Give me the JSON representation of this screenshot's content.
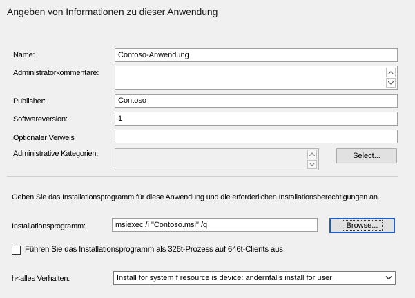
{
  "header": {
    "title": "Angeben von Informationen zu dieser Anwendung"
  },
  "form": {
    "name_label": "Name:",
    "name_value": "Contoso-Anwendung",
    "admin_comment_label": "Administratorkommentare:",
    "admin_comment_value": "",
    "publisher_label": "Publisher:",
    "publisher_value": "Contoso",
    "version_label": "Softwareversion:",
    "version_value": "1",
    "optional_ref_label": "Optionaler Verweis",
    "optional_ref_value": "",
    "categories_label": "Administrative Kategorien:",
    "categories_value": "",
    "select_button": "Select..."
  },
  "installer": {
    "instruction": "Geben Sie das Installationsprogramm für diese Anwendung und die erforderlichen Installationsberechtigungen an.",
    "program_label": "Installationsprogramm:",
    "program_value": "msiexec /i \"Contoso.msi\" /q",
    "browse_button": "Browse...",
    "checkbox_label": "Führen Sie das Installationsprogramm als 326t-Prozess auf 646t-Clients aus.",
    "checkbox_checked": false,
    "behavior_label": "h<alles Verhalten:",
    "behavior_value": "Install for system f resource is device: andernfalls install for user"
  }
}
